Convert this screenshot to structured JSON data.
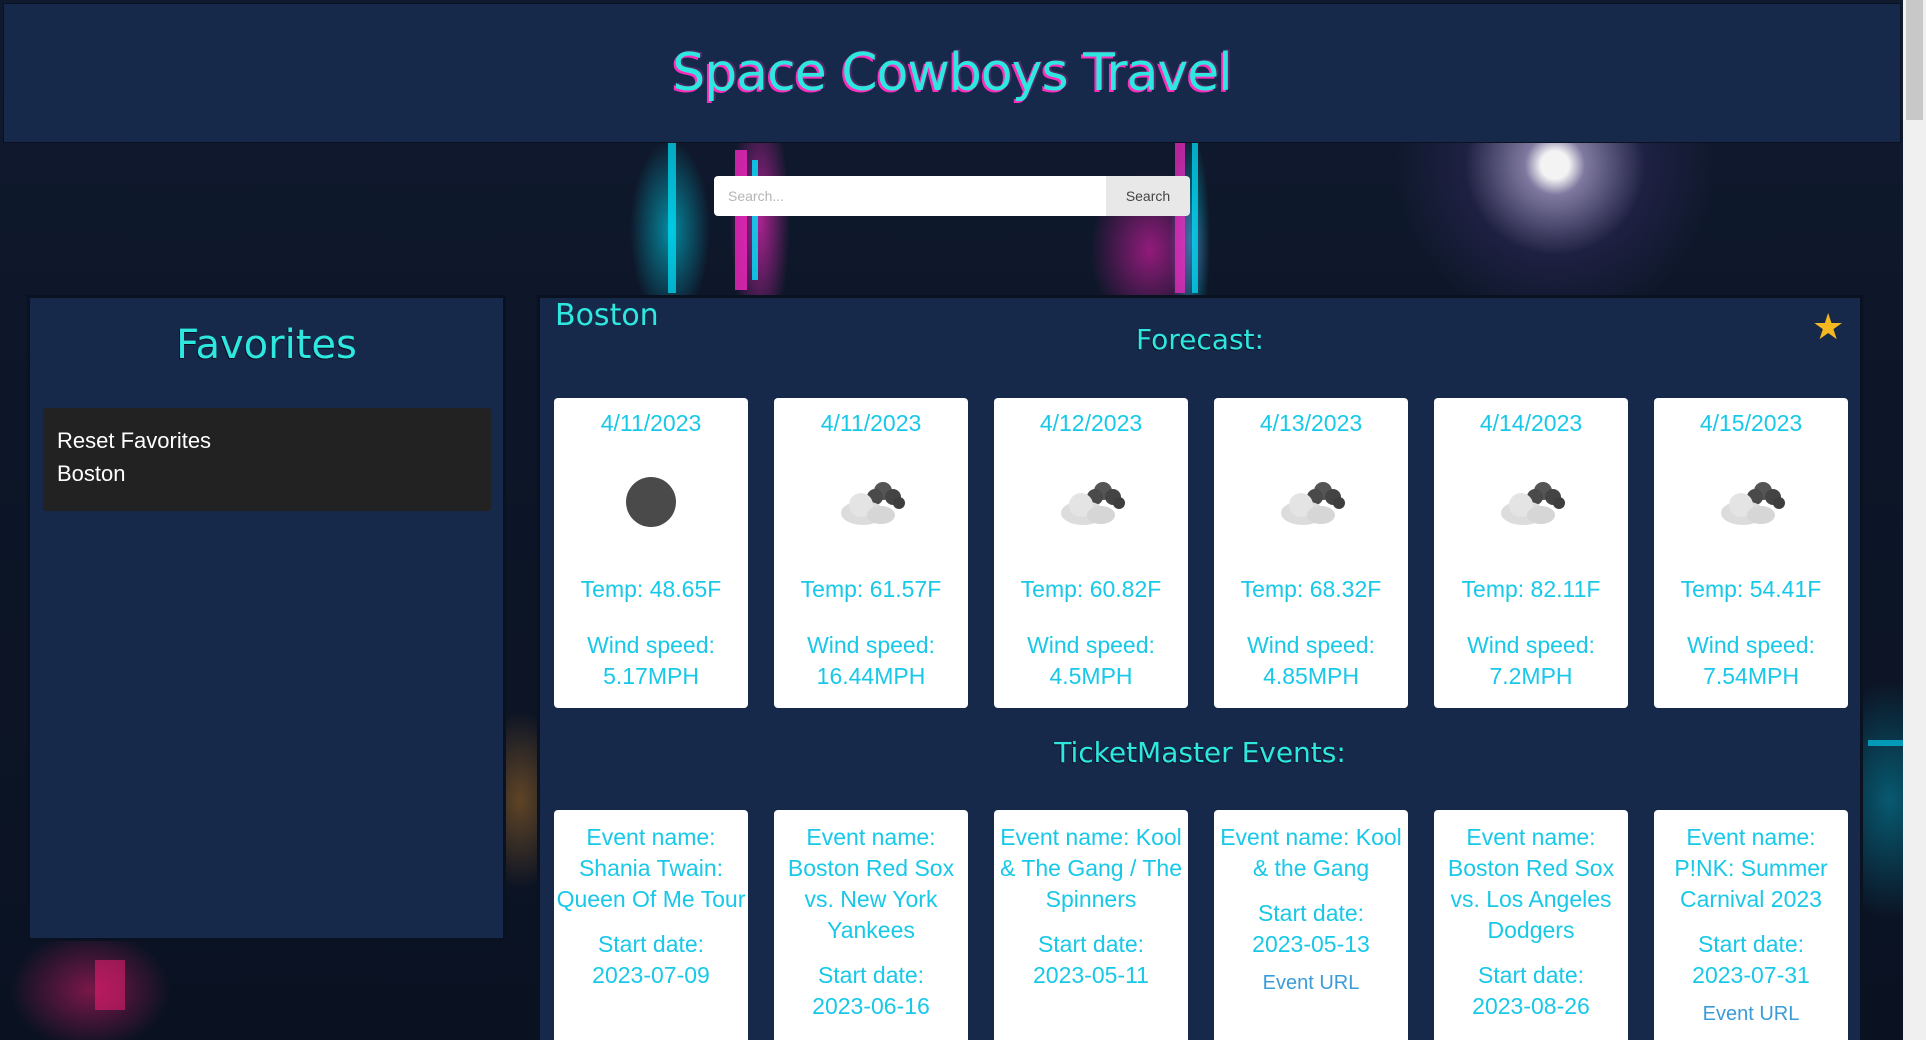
{
  "header": {
    "title": "Space Cowboys Travel"
  },
  "search": {
    "placeholder": "Search...",
    "button_label": "Search"
  },
  "favorites": {
    "title": "Favorites",
    "items": [
      "Reset Favorites",
      "Boston"
    ]
  },
  "main": {
    "city": "Boston",
    "forecast_title": "Forecast:",
    "events_title": "TicketMaster Events:",
    "star_color": "#f5b820",
    "forecast": [
      {
        "date": "4/11/2023",
        "icon": "dark-circle-icon",
        "temp": "Temp: 48.65F",
        "wind_label": "Wind speed:",
        "wind": "5.17MPH"
      },
      {
        "date": "4/11/2023",
        "icon": "broken-clouds-icon",
        "temp": "Temp: 61.57F",
        "wind_label": "Wind speed:",
        "wind": "16.44MPH"
      },
      {
        "date": "4/12/2023",
        "icon": "broken-clouds-icon",
        "temp": "Temp: 60.82F",
        "wind_label": "Wind speed:",
        "wind": "4.5MPH"
      },
      {
        "date": "4/13/2023",
        "icon": "broken-clouds-icon",
        "temp": "Temp: 68.32F",
        "wind_label": "Wind speed:",
        "wind": "4.85MPH"
      },
      {
        "date": "4/14/2023",
        "icon": "broken-clouds-icon",
        "temp": "Temp: 82.11F",
        "wind_label": "Wind speed:",
        "wind": "7.2MPH"
      },
      {
        "date": "4/15/2023",
        "icon": "broken-clouds-icon",
        "temp": "Temp: 54.41F",
        "wind_label": "Wind speed:",
        "wind": "7.54MPH"
      }
    ],
    "events": [
      {
        "name": "Event name: Shania Twain: Queen Of Me Tour",
        "start_label": "Start date:",
        "start": "2023-07-09",
        "url": ""
      },
      {
        "name": "Event name: Boston Red Sox vs. New York Yankees",
        "start_label": "Start date:",
        "start": "2023-06-16",
        "url": ""
      },
      {
        "name": "Event name: Kool & The Gang / The Spinners",
        "start_label": "Start date:",
        "start": "2023-05-11",
        "url": ""
      },
      {
        "name": "Event name: Kool & the Gang",
        "start_label": "Start date:",
        "start": "2023-05-13",
        "url": "Event URL"
      },
      {
        "name": "Event name: Boston Red Sox vs. Los Angeles Dodgers",
        "start_label": "Start date:",
        "start": "2023-08-26",
        "url": ""
      },
      {
        "name": "Event name: P!NK: Summer Carnival 2023",
        "start_label": "Start date:",
        "start": "2023-07-31",
        "url": "Event URL"
      }
    ]
  }
}
